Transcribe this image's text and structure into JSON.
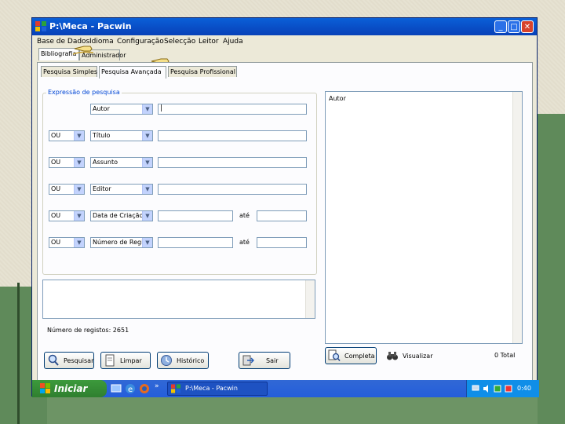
{
  "window": {
    "title": "P:\\Meca - Pacwin",
    "controls": {
      "minimize": "_",
      "maximize": "□",
      "close": "✕"
    }
  },
  "menu": [
    "Base de Dados",
    "Idioma",
    "Configuração",
    "Selecção",
    "Leitor",
    "Ajuda"
  ],
  "main_tabs": {
    "bibliografia": "Bibliografia",
    "administrador": "Administrador"
  },
  "sub_tabs": {
    "simples": "Pesquisa Simples",
    "avancada": "Pesquisa Avançada",
    "profissional": "Pesquisa Profissional"
  },
  "search": {
    "group_label": "Expressão de pesquisa",
    "rows": [
      {
        "operator": "",
        "field": "Autor",
        "value": "|"
      },
      {
        "operator": "OU",
        "field": "Título",
        "value": ""
      },
      {
        "operator": "OU",
        "field": "Assunto",
        "value": ""
      },
      {
        "operator": "OU",
        "field": "Editor",
        "value": ""
      },
      {
        "operator": "OU",
        "field": "Data de Criação",
        "value": "",
        "ate": "até"
      },
      {
        "operator": "OU",
        "field": "Número de Regi",
        "value": "",
        "ate": "até"
      }
    ]
  },
  "records_label": "Número de registos: 2651",
  "results": {
    "header": "Autor",
    "total": "0 Total"
  },
  "buttons": {
    "pesquisar": "Pesquisar",
    "limpar": "Limpar",
    "historico": "Histórico",
    "sair": "Sair",
    "completa": "Completa",
    "visualizar": "Visualizar"
  },
  "taskbar": {
    "start": "Iniciar",
    "task": "P:\\Meca - Pacwin",
    "clock": "0:40",
    "chevron": "»"
  },
  "colors": {
    "title_bar": "#0a5fd8",
    "start_button": "#3c9a3c",
    "taskbar": "#245edb",
    "group_label": "#0046d5"
  }
}
